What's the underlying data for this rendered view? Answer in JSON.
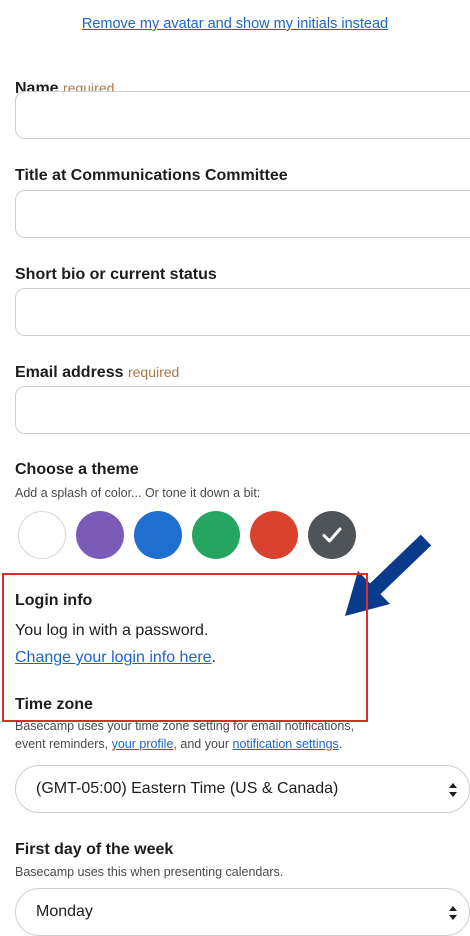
{
  "profile": {
    "remove_avatar_link": "Remove my avatar and show my initials instead",
    "required_tag": "required",
    "name_label": "Name",
    "title_label": "Title at Communications Committee",
    "bio_label": "Short bio or current status",
    "email_label": "Email address"
  },
  "theme": {
    "heading": "Choose a theme",
    "subtitle": "Add a splash of color... Or tone it down a bit:",
    "swatches": [
      {
        "name": "white",
        "color": "#ffffff"
      },
      {
        "name": "purple",
        "color": "#7a5bb8"
      },
      {
        "name": "blue",
        "color": "#1f6fd0"
      },
      {
        "name": "green",
        "color": "#25a55f"
      },
      {
        "name": "red",
        "color": "#d9422e"
      },
      {
        "name": "gray",
        "color": "#4f5458",
        "selected": true
      }
    ]
  },
  "login": {
    "heading": "Login info",
    "description": "You log in with a password.",
    "change_link": "Change your login info here",
    "change_link_suffix": "."
  },
  "timezone": {
    "heading": "Time zone",
    "help_line1": "Basecamp uses your time zone setting for email notifications,",
    "help_line2_prefix": "event reminders, ",
    "your_profile_link": "your profile",
    "help_line2_middle": ", and your ",
    "notification_settings_link": "notification settings",
    "help_line2_suffix": ".",
    "selected": "(GMT-05:00) Eastern Time (US & Canada)"
  },
  "first_day": {
    "heading": "First day of the week",
    "help": "Basecamp uses this when presenting calendars.",
    "selected": "Monday"
  },
  "colors": {
    "link": "#1a66c7",
    "required": "#a57a45",
    "highlight_box": "#e02b2b",
    "annotation_arrow": "#0a3a8c"
  }
}
